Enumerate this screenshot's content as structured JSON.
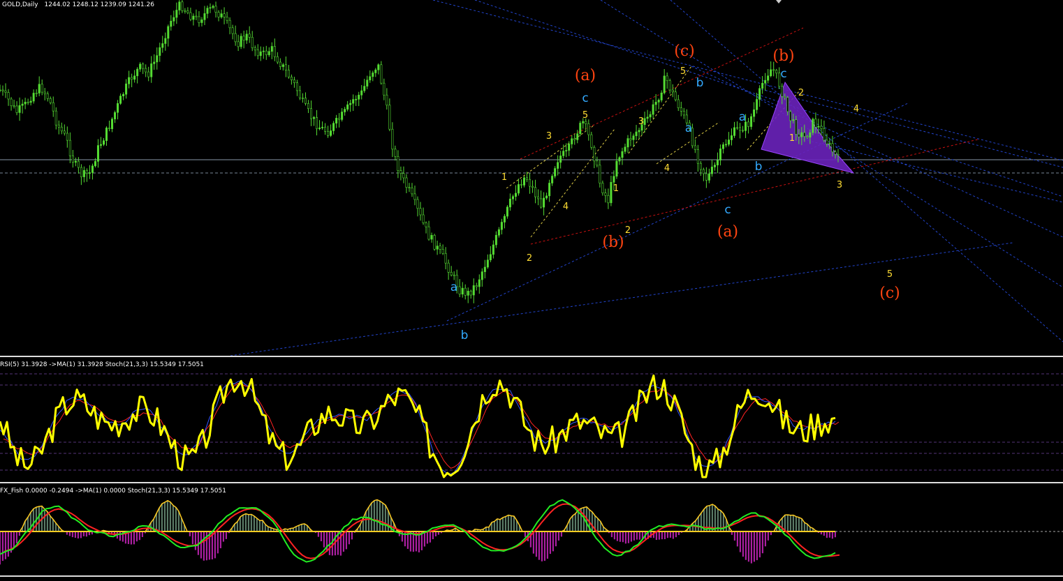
{
  "main_header": {
    "symbol": "GOLD,Daily",
    "ohlc": "1244.02 1248.12 1239.09 1241.26"
  },
  "rsi_header": "RSI(5) 31.3928  ->MA(1) 31.3928  Stoch(21,3,3) 15.5349 17.5051",
  "fish_header": "FX_Fish 0.0000 -0.2494  ->MA(1) 0.0000  Stoch(21,3,3) 15.5349 17.5051",
  "colors": {
    "background": "#000000",
    "candles": "#55dd33",
    "wave_minor": "#ffdd33",
    "wave_intermediate": "#33aaff",
    "wave_major": "#ff4411",
    "trend_blue": "#2244cc",
    "trend_red": "#cc1111",
    "rsi_line": "#ffff00",
    "stoch_main": "#3355ff",
    "stoch_signal": "#ff2222",
    "fish_positive": "#5a7a66",
    "fish_negative": "#aa1fa0",
    "fish_line": "#ffcc22",
    "pattern_fill": "#6a22bb"
  },
  "chart_data": [
    {
      "type": "candlestick",
      "title": "GOLD,Daily",
      "ohlc_last": {
        "open": 1244.02,
        "high": 1248.12,
        "low": 1239.09,
        "close": 1241.26
      },
      "price_path": [
        0.73,
        0.7,
        0.66,
        0.68,
        0.72,
        0.74,
        0.7,
        0.62,
        0.58,
        0.5,
        0.46,
        0.47,
        0.55,
        0.6,
        0.66,
        0.72,
        0.77,
        0.8,
        0.78,
        0.83,
        0.9,
        0.96,
        1.0,
        0.97,
        0.95,
        0.97,
        0.99,
        0.96,
        0.92,
        0.88,
        0.9,
        0.86,
        0.84,
        0.86,
        0.82,
        0.78,
        0.74,
        0.68,
        0.64,
        0.61,
        0.6,
        0.63,
        0.66,
        0.7,
        0.72,
        0.78,
        0.81,
        0.68,
        0.52,
        0.45,
        0.4,
        0.34,
        0.28,
        0.24,
        0.2,
        0.15,
        0.1,
        0.09,
        0.12,
        0.18,
        0.24,
        0.3,
        0.37,
        0.43,
        0.46,
        0.41,
        0.36,
        0.46,
        0.52,
        0.53,
        0.59,
        0.63,
        0.56,
        0.44,
        0.38,
        0.51,
        0.55,
        0.59,
        0.61,
        0.65,
        0.7,
        0.77,
        0.71,
        0.66,
        0.59,
        0.51,
        0.45,
        0.49,
        0.55,
        0.59,
        0.61,
        0.62,
        0.68,
        0.77,
        0.8,
        0.74,
        0.65,
        0.6,
        0.58,
        0.63,
        0.6,
        0.55,
        0.51
      ],
      "wave_labels": {
        "minor": [
          "1",
          "2",
          "3",
          "4",
          "5",
          "1",
          "2",
          "3",
          "4",
          "5",
          "1",
          "2",
          "3",
          "4",
          "5"
        ],
        "intermediate": [
          "a",
          "b",
          "c",
          "a",
          "b",
          "c",
          "a",
          "b",
          "c"
        ],
        "major": [
          "(a)",
          "(b)",
          "(c)",
          "(a)",
          "(b)",
          "(c)"
        ]
      }
    },
    {
      "type": "line",
      "title": "RSI(5) 31.3928 ->MA(1) 31.3928 Stoch(21,3,3) 15.5349 17.5051",
      "series": [
        {
          "name": "RSI(5)",
          "last": 31.3928
        },
        {
          "name": "Stoch(21,3,3) main",
          "last": 15.5349
        },
        {
          "name": "Stoch(21,3,3) signal",
          "last": 17.5051
        }
      ]
    },
    {
      "type": "bar",
      "title": "FX_Fish 0.0000 -0.2494 ->MA(1) 0.0000 Stoch(21,3,3) 15.5349 17.5051",
      "series": [
        {
          "name": "FX_Fish",
          "last": 0.0
        },
        {
          "name": "FX_Fish signal",
          "last": -0.2494
        },
        {
          "name": "Stoch(21,3,3) main",
          "last": 15.5349
        },
        {
          "name": "Stoch(21,3,3) signal",
          "last": 17.5051
        }
      ]
    }
  ],
  "wave_annotations": [
    {
      "text": "(a)",
      "tier": "major"
    },
    {
      "text": "c",
      "tier": "intermediate"
    },
    {
      "text": "5",
      "tier": "minor"
    },
    {
      "text": "3",
      "tier": "minor"
    },
    {
      "text": "1",
      "tier": "minor"
    },
    {
      "text": "4",
      "tier": "minor"
    },
    {
      "text": "2",
      "tier": "minor"
    },
    {
      "text": "a",
      "tier": "intermediate"
    },
    {
      "text": "b",
      "tier": "intermediate"
    },
    {
      "text": "(b)",
      "tier": "major"
    },
    {
      "text": "2",
      "tier": "minor"
    },
    {
      "text": "1",
      "tier": "minor"
    },
    {
      "text": "3",
      "tier": "minor"
    },
    {
      "text": "4",
      "tier": "minor"
    },
    {
      "text": "5",
      "tier": "minor"
    },
    {
      "text": "(c)",
      "tier": "major"
    },
    {
      "text": "b",
      "tier": "intermediate"
    },
    {
      "text": "a",
      "tier": "intermediate"
    },
    {
      "text": "c",
      "tier": "intermediate"
    },
    {
      "text": "(a)",
      "tier": "major"
    },
    {
      "text": "a",
      "tier": "intermediate"
    },
    {
      "text": "b",
      "tier": "intermediate"
    },
    {
      "text": "(b)",
      "tier": "major"
    },
    {
      "text": "c",
      "tier": "intermediate"
    },
    {
      "text": "2",
      "tier": "minor"
    },
    {
      "text": "1",
      "tier": "minor"
    },
    {
      "text": "3",
      "tier": "minor"
    },
    {
      "text": "4",
      "tier": "minor"
    },
    {
      "text": "5",
      "tier": "minor"
    },
    {
      "text": "(c)",
      "tier": "major"
    }
  ]
}
